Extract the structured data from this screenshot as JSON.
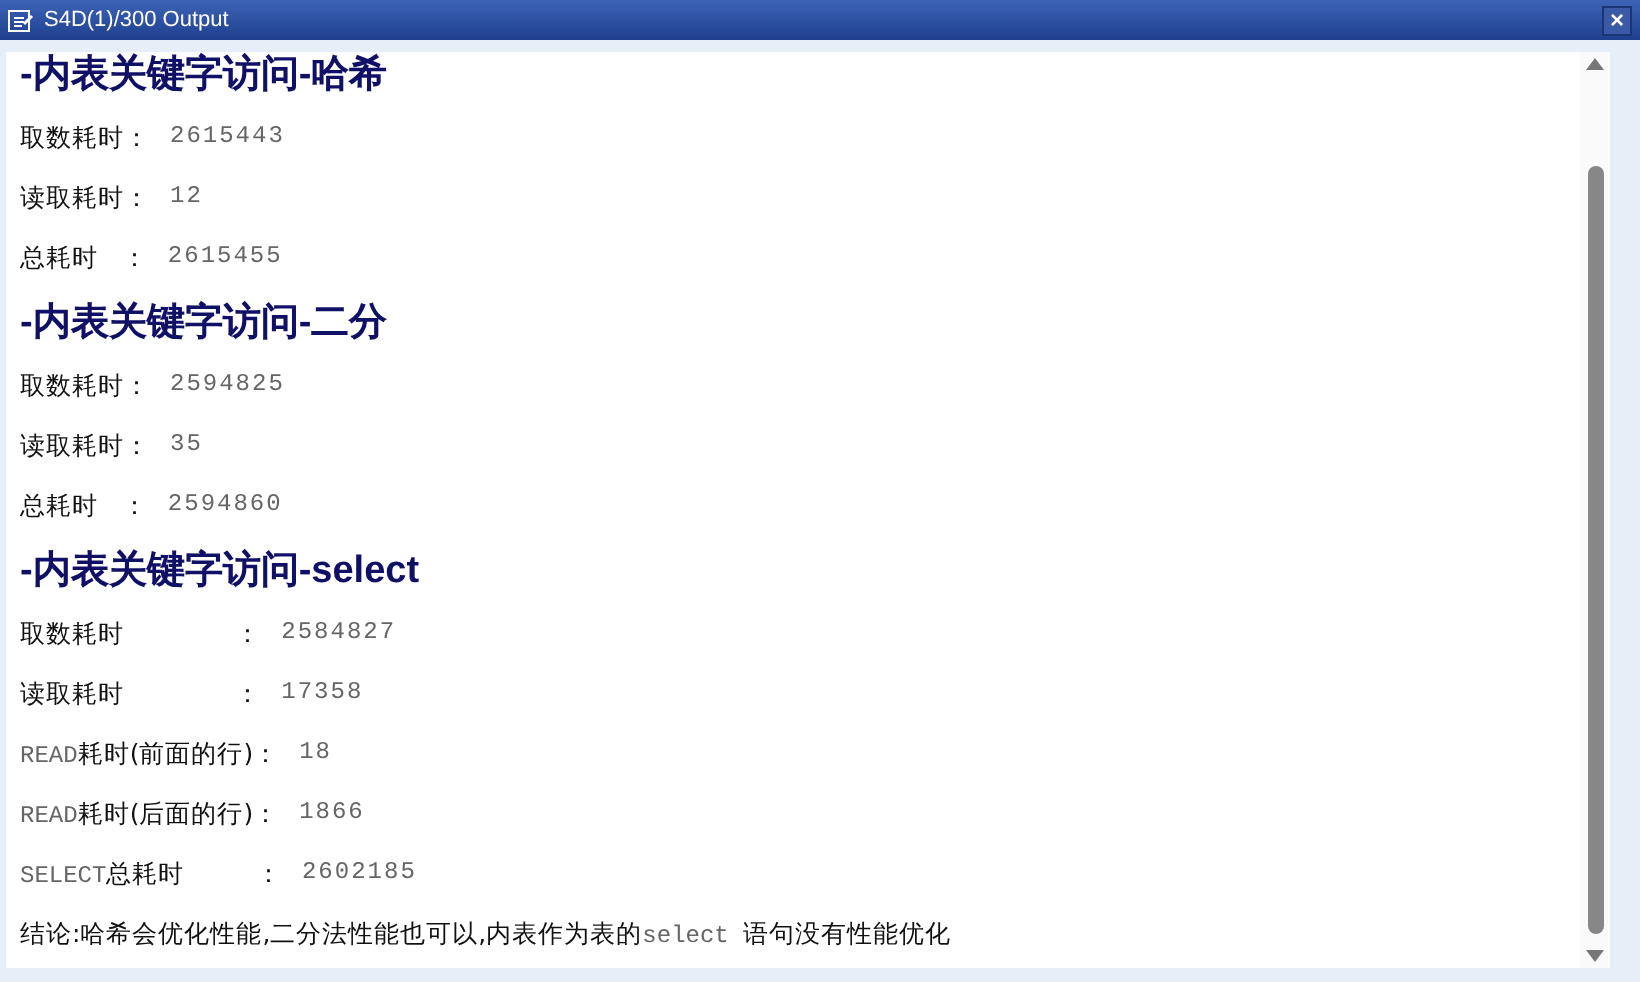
{
  "window": {
    "title": "S4D(1)/300 Output",
    "close": "×"
  },
  "sections": [
    {
      "heading": "-内表关键字访问-哈希",
      "rows": [
        {
          "label": [
            {
              "kind": "plain",
              "text": "取数耗时："
            }
          ],
          "value": "2615443"
        },
        {
          "label": [
            {
              "kind": "plain",
              "text": "读取耗时："
            }
          ],
          "value": "12"
        },
        {
          "label": [
            {
              "kind": "plain",
              "text": "总耗时   ："
            }
          ],
          "value": "2615455"
        }
      ]
    },
    {
      "heading": "-内表关键字访问-二分",
      "rows": [
        {
          "label": [
            {
              "kind": "plain",
              "text": "取数耗时："
            }
          ],
          "value": "2594825"
        },
        {
          "label": [
            {
              "kind": "plain",
              "text": "读取耗时："
            }
          ],
          "value": "35"
        },
        {
          "label": [
            {
              "kind": "plain",
              "text": "总耗时   ："
            }
          ],
          "value": "2594860"
        }
      ]
    },
    {
      "heading": "-内表关键字访问-select",
      "rows": [
        {
          "label": [
            {
              "kind": "plain",
              "text": "取数耗时              ："
            }
          ],
          "value": "2584827"
        },
        {
          "label": [
            {
              "kind": "plain",
              "text": "读取耗时              ："
            }
          ],
          "value": "17358"
        },
        {
          "label": [
            {
              "kind": "code",
              "text": "READ"
            },
            {
              "kind": "plain",
              "text": "耗时(前面的行)："
            }
          ],
          "value": "18"
        },
        {
          "label": [
            {
              "kind": "code",
              "text": "READ"
            },
            {
              "kind": "plain",
              "text": "耗时(后面的行)："
            }
          ],
          "value": "1866"
        },
        {
          "label": [
            {
              "kind": "code",
              "text": "SELECT"
            },
            {
              "kind": "plain",
              "text": "总耗时         ："
            }
          ],
          "value": "2602185"
        }
      ]
    }
  ],
  "conclusion": [
    {
      "kind": "plain",
      "text": "结论:哈希会优化性能,二分法性能也可以,内表作为表的"
    },
    {
      "kind": "code",
      "text": "select "
    },
    {
      "kind": "plain",
      "text": "语句没有性能优化"
    }
  ]
}
